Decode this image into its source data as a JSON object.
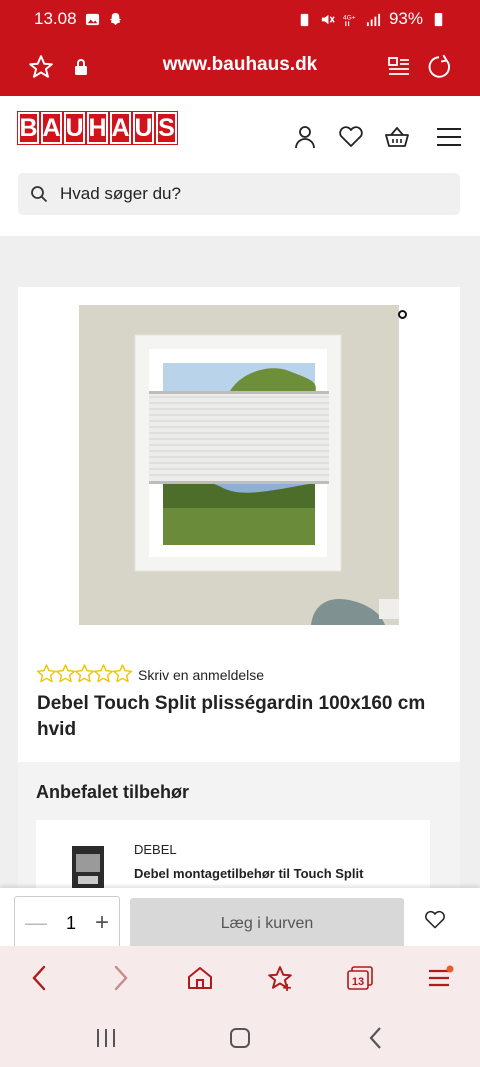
{
  "status_bar": {
    "time": "13.08",
    "battery": "93%"
  },
  "browser": {
    "url": "www.bauhaus.dk",
    "tab_count": "13"
  },
  "header": {
    "logo_letters": [
      "B",
      "A",
      "U",
      "H",
      "A",
      "U",
      "S"
    ],
    "search_placeholder": "Hvad søger du?"
  },
  "product": {
    "review_link": "Skriv en anmeldelse",
    "title": "Debel Touch Split plisségardin 100x160 cm hvid",
    "rating_stars": 5
  },
  "accessories": {
    "heading": "Anbefalet tilbehør",
    "items": [
      {
        "brand": "DEBEL",
        "name": "Debel montagetilbehør til Touch Split"
      }
    ]
  },
  "buy_bar": {
    "quantity": "1",
    "add_to_cart": "Læg i kurven"
  },
  "colors": {
    "brand_red": "#c8131b",
    "star_yellow": "#f2c200"
  }
}
